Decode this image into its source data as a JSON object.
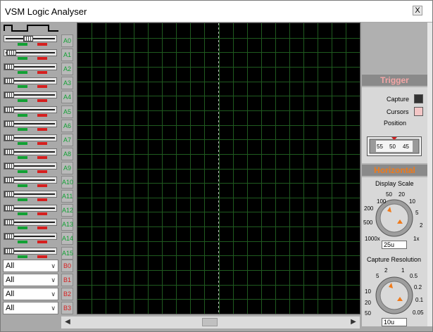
{
  "window": {
    "title": "VSM Logic Analyser",
    "close_label": "X"
  },
  "channels_a": [
    "A0",
    "A1",
    "A2",
    "A3",
    "A4",
    "A5",
    "A6",
    "A7",
    "A8",
    "A9",
    "A10",
    "A11",
    "A12",
    "A13",
    "A14",
    "A15"
  ],
  "channel_knob_levels": [
    0.45,
    0.05,
    0.0,
    0.0,
    0.0,
    0.0,
    0.0,
    0.0,
    0.0,
    0.0,
    0.0,
    0.0,
    0.0,
    0.0,
    0.0,
    0.0
  ],
  "bus_rows": [
    {
      "select": "All",
      "label": "B0"
    },
    {
      "select": "All",
      "label": "B1"
    },
    {
      "select": "All",
      "label": "B2"
    },
    {
      "select": "All",
      "label": "B3"
    }
  ],
  "trigger": {
    "header": "Trigger",
    "capture_label": "Capture",
    "cursors_label": "Cursors",
    "position_label": "Position",
    "position_ticks": [
      "55",
      "50",
      "45"
    ]
  },
  "horizontal": {
    "header": "Horizontal",
    "display_scale": {
      "label": "Display Scale",
      "ticks": [
        "100",
        "50",
        "20",
        "10",
        "5",
        "2",
        "1x",
        "1000x",
        "500",
        "200"
      ],
      "value": "25u"
    },
    "capture_resolution": {
      "label": "Capture Resolution",
      "ticks": [
        "5",
        "2",
        "1",
        "0.5",
        "0.2",
        "0.1",
        "0.05",
        "10",
        "20",
        "50"
      ],
      "value": "10u"
    }
  },
  "colors": {
    "led_high": "#11a033",
    "led_low": "#d61e1e",
    "grid": "#1f5a1f",
    "trigger_cursor": "#bbbbbb"
  },
  "icons": {
    "clock": "clock-waveform-icon",
    "scroll_left": "arrow-left-icon",
    "scroll_right": "arrow-right-icon"
  }
}
